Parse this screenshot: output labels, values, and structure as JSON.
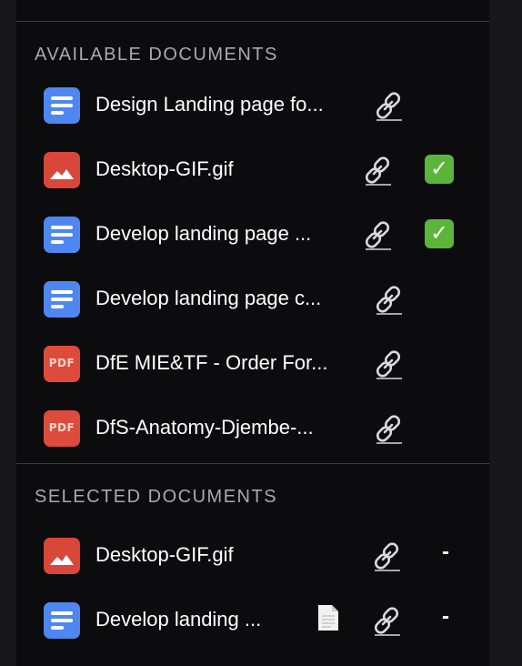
{
  "available": {
    "title": "AVAILABLE DOCUMENTS",
    "items": [
      {
        "name": "Design Landing page fo...",
        "type": "doc",
        "icon": "google-doc-icon",
        "link": "link-icon",
        "added": false
      },
      {
        "name": "Desktop-GIF.gif",
        "type": "image",
        "icon": "image-file-icon",
        "link": "link-icon",
        "added": true
      },
      {
        "name": "Develop landing page ...",
        "type": "doc",
        "icon": "google-doc-icon",
        "link": "link-icon",
        "added": true
      },
      {
        "name": "Develop landing page c...",
        "type": "doc",
        "icon": "google-doc-icon",
        "link": "link-icon",
        "added": false
      },
      {
        "name": "DfE MIE&TF - Order For...",
        "type": "pdf",
        "icon": "pdf-file-icon",
        "link": "link-icon",
        "added": false
      },
      {
        "name": "DfS-Anatomy-Djembe-...",
        "type": "pdf",
        "icon": "pdf-file-icon",
        "link": "link-icon",
        "added": false
      }
    ],
    "pdf_label": "PDF",
    "check_glyph": "✓"
  },
  "selected": {
    "title": "SELECTED DOCUMENTS",
    "items": [
      {
        "name": "Desktop-GIF.gif",
        "type": "image",
        "icon": "image-file-icon",
        "link": "link-icon",
        "remove_label": "-"
      },
      {
        "name": "Develop landing ...",
        "type": "doc",
        "icon": "google-doc-icon",
        "extra_icon": "page-icon",
        "link": "link-icon",
        "remove_label": "-"
      }
    ]
  },
  "colors": {
    "doc": "#4f87f0",
    "image": "#d8473a",
    "pdf": "#dd4b3d",
    "check": "#5ab53a"
  }
}
